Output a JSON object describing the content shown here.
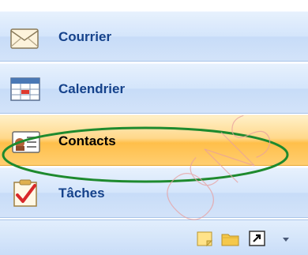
{
  "nav": {
    "items": [
      {
        "label": "Courrier",
        "icon": "envelope-icon"
      },
      {
        "label": "Calendrier",
        "icon": "calendar-icon"
      },
      {
        "label": "Contacts",
        "icon": "contact-card-icon",
        "selected": true
      },
      {
        "label": "Tâches",
        "icon": "task-checklist-icon"
      }
    ]
  },
  "bottom_bar": {
    "icons": [
      "notes-icon",
      "folder-icon",
      "shortcut-icon",
      "configure-buttons-icon"
    ]
  },
  "colors": {
    "item_gradient_top": "#e7f1fd",
    "item_gradient_bottom": "#c7dcf8",
    "selected_gradient_mid": "#ffbf4a",
    "label_text": "#15428b",
    "annotation_ellipse": "#1e8a2e",
    "watermark": "#e8a0a0"
  }
}
